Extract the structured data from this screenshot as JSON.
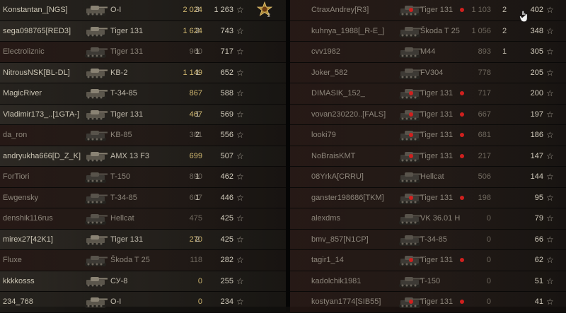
{
  "star_glyph": "☆",
  "left_team": [
    {
      "player": "Konstantan_[NGS]",
      "tank": "O-I",
      "damage": "2 024",
      "kills": "3",
      "xp": "1 263",
      "dmg_style": "gold",
      "dead": false,
      "medal": true,
      "medal_count": "2"
    },
    {
      "player": "sega098765[RED3]",
      "tank": "Tiger 131",
      "damage": "1 624",
      "kills": "2",
      "xp": "743",
      "dmg_style": "gold",
      "dead": false
    },
    {
      "player": "Electroliznic",
      "tank": "Tiger 131",
      "damage": "960",
      "kills": "1",
      "xp": "717",
      "dmg_style": "dim",
      "dead": true
    },
    {
      "player": "NitrousNSK[BL-DL]",
      "tank": "KB-2",
      "damage": "1 149",
      "kills": "1",
      "xp": "652",
      "dmg_style": "gold",
      "dead": false
    },
    {
      "player": "MagicRiver",
      "tank": "T-34-85",
      "damage": "867",
      "kills": "",
      "xp": "588",
      "dmg_style": "gold",
      "dead": false
    },
    {
      "player": "Vladimir173_..[1GTA-]",
      "tank": "Tiger 131",
      "damage": "467",
      "kills": "1",
      "xp": "569",
      "dmg_style": "gold",
      "dead": false
    },
    {
      "player": "da_ron",
      "tank": "KB-85",
      "damage": "381",
      "kills": "2",
      "xp": "556",
      "dmg_style": "dim",
      "dead": true
    },
    {
      "player": "andryukha666[D_Z_K]",
      "tank": "AMX 13 F3",
      "damage": "699",
      "kills": "",
      "xp": "507",
      "dmg_style": "gold",
      "dead": false
    },
    {
      "player": "ForTiori",
      "tank": "T-150",
      "damage": "890",
      "kills": "1",
      "xp": "462",
      "dmg_style": "dim",
      "dead": true
    },
    {
      "player": "Ewgensky",
      "tank": "T-34-85",
      "damage": "607",
      "kills": "1",
      "xp": "446",
      "dmg_style": "dim",
      "dead": true
    },
    {
      "player": "denshik116rus",
      "tank": "Hellcat",
      "damage": "475",
      "kills": "",
      "xp": "425",
      "dmg_style": "dim",
      "dead": true
    },
    {
      "player": "mirex27[42K1]",
      "tank": "Tiger 131",
      "damage": "270",
      "kills": "2",
      "xp": "425",
      "dmg_style": "gold",
      "dead": false
    },
    {
      "player": "Fluxe",
      "tank": "Škoda T 25",
      "damage": "118",
      "kills": "",
      "xp": "282",
      "dmg_style": "dim",
      "dead": true
    },
    {
      "player": "kkkkosss",
      "tank": "СУ-8",
      "damage": "0",
      "kills": "",
      "xp": "255",
      "dmg_style": "gold",
      "dead": false
    },
    {
      "player": "234_768",
      "tank": "O-I",
      "damage": "0",
      "kills": "",
      "xp": "234",
      "dmg_style": "gold",
      "dead": false
    }
  ],
  "right_team": [
    {
      "player": "CtraxAndrey[R3]",
      "tank": "Tiger 131",
      "damage": "1 103",
      "kills": "2",
      "xp": "402",
      "dead": true,
      "dot1": true,
      "dot2": true,
      "cursor": true
    },
    {
      "player": "kuhnya_1988[_R-E_]",
      "tank": "Škoda T 25",
      "damage": "1 056",
      "kills": "2",
      "xp": "348",
      "dead": true
    },
    {
      "player": "cvv1982",
      "tank": "M44",
      "damage": "893",
      "kills": "1",
      "xp": "305",
      "dead": true
    },
    {
      "player": "Joker_582",
      "tank": "FV304",
      "damage": "778",
      "kills": "",
      "xp": "205",
      "dead": true
    },
    {
      "player": "DIMASIK_152_",
      "tank": "Tiger 131",
      "damage": "717",
      "kills": "",
      "xp": "200",
      "dead": true,
      "dot1": true,
      "dot2": true
    },
    {
      "player": "vovan230220..[FALS]",
      "tank": "Tiger 131",
      "damage": "667",
      "kills": "",
      "xp": "197",
      "dead": true,
      "dot1": true,
      "dot2": true
    },
    {
      "player": "looki79",
      "tank": "Tiger 131",
      "damage": "681",
      "kills": "",
      "xp": "186",
      "dead": true,
      "dot1": true,
      "dot2": true
    },
    {
      "player": "NoBraisKMT",
      "tank": "Tiger 131",
      "damage": "217",
      "kills": "",
      "xp": "147",
      "dead": true,
      "dot1": true,
      "dot2": true
    },
    {
      "player": "08YrkA[CRRU]",
      "tank": "Hellcat",
      "damage": "506",
      "kills": "",
      "xp": "144",
      "dead": true
    },
    {
      "player": "ganster198686[TKM]",
      "tank": "Tiger 131",
      "damage": "198",
      "kills": "",
      "xp": "95",
      "dead": true,
      "dot1": true,
      "dot2": true
    },
    {
      "player": "alexdms",
      "tank": "VK 36.01 H",
      "damage": "0",
      "kills": "",
      "xp": "79",
      "dead": true
    },
    {
      "player": "bmv_857[N1CP]",
      "tank": "T-34-85",
      "damage": "0",
      "kills": "",
      "xp": "66",
      "dead": true
    },
    {
      "player": "tagir1_14",
      "tank": "Tiger 131",
      "damage": "0",
      "kills": "",
      "xp": "62",
      "dead": true,
      "dot1": true,
      "dot2": true
    },
    {
      "player": "kadolchik1981",
      "tank": "T-150",
      "damage": "0",
      "kills": "",
      "xp": "51",
      "dead": true
    },
    {
      "player": "kostyan1774[SIB55]",
      "tank": "Tiger 131",
      "damage": "0",
      "kills": "",
      "xp": "41",
      "dead": true,
      "dot1": true,
      "dot2": true
    }
  ]
}
